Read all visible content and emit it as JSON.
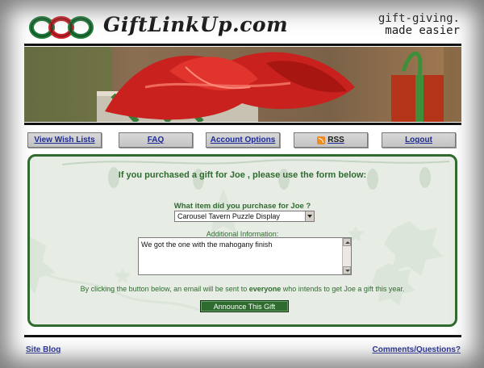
{
  "header": {
    "site_name": "GiftLinkUp.com",
    "tagline_line1": "gift-giving.",
    "tagline_line2": "made easier"
  },
  "nav": {
    "items": [
      {
        "label": "View Wish Lists"
      },
      {
        "label": "FAQ"
      },
      {
        "label": "Account Options"
      },
      {
        "label": "RSS"
      },
      {
        "label": "Logout"
      }
    ]
  },
  "form": {
    "heading": "If you purchased a gift for Joe , please use the form below:",
    "item_label": "What item did you purchase for Joe ?",
    "item_selected": "Carousel Tavern Puzzle Display",
    "additional_label": "Additional Information:",
    "additional_value": "We got the one with the mahogany finish",
    "notice_before": "By clicking the button below, an email will be sent to",
    "notice_bold": "everyone",
    "notice_after": "who intends to get Joe a gift this year.",
    "submit_label": "Announce This Gift"
  },
  "footer": {
    "left_link": "Site Blog",
    "right_link": "Comments/Questions?"
  },
  "colors": {
    "accent_green": "#2f6b2f",
    "link_blue": "#1d2a96",
    "logo_red": "#c9232a",
    "logo_green": "#1f7a3a"
  }
}
